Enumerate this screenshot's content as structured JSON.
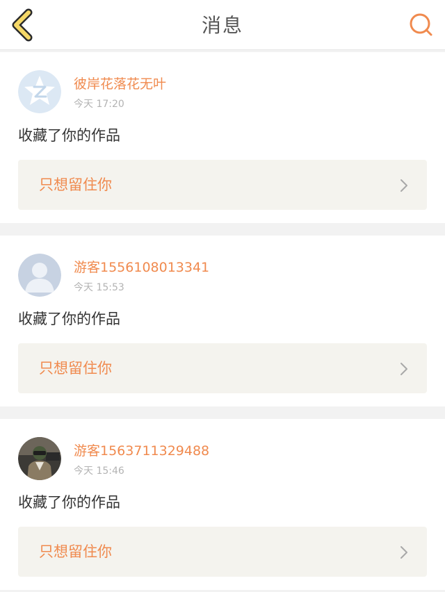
{
  "header": {
    "title": "消息",
    "back_icon": "chevron-left-icon",
    "search_icon": "search-icon"
  },
  "colors": {
    "accent": "#f08a4e",
    "back_icon_fill": "#f5d867",
    "card_background": "#ffffff",
    "work_background": "#f4f3ee",
    "page_background": "#f2f2f2"
  },
  "messages": [
    {
      "avatar": "qzone-avatar-icon",
      "username": "彼岸花落花无叶",
      "time": "今天 17:20",
      "action": "收藏了你的作品",
      "work_title": "只想留住你"
    },
    {
      "avatar": "default-user-avatar-icon",
      "username": "游客1556108013341",
      "time": "今天 15:53",
      "action": "收藏了你的作品",
      "work_title": "只想留住你"
    },
    {
      "avatar": "game-character-avatar-icon",
      "username": "游客1563711329488",
      "time": "今天 15:46",
      "action": "收藏了你的作品",
      "work_title": "只想留住你"
    }
  ]
}
